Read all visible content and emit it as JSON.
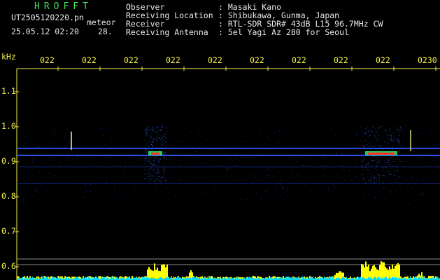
{
  "header": {
    "brand": "HROFFT",
    "filename": "UT2505120220.pn",
    "mode": "meteor",
    "datetime": "25.05.12 02:20",
    "count": "28.",
    "info": [
      {
        "label": "Observer",
        "value": ": Masaki Kano"
      },
      {
        "label": "Receiving Location",
        "value": ": Shibukawa, Gunma, Japan"
      },
      {
        "label": "Receiver",
        "value": ": RTL-SDR SDR# 43dB L15 96.7MHz CW"
      },
      {
        "label": "Receiving Antenna",
        "value": ": 5el Yagi Az 280 for Seoul"
      }
    ]
  },
  "axes": {
    "y_unit": "kHz",
    "y_ticks": [
      "1.1",
      "1.0",
      "0.9",
      "0.8",
      "0.7",
      "0.6"
    ],
    "x_ticks": [
      "022",
      "022",
      "022",
      "022",
      "022",
      "022",
      "022",
      "022",
      "022",
      "0230"
    ]
  },
  "colors": {
    "text": "#e8e8e8",
    "labels": "#f2f24a",
    "brand": "#3fe05a",
    "carrier": "#2a55ff",
    "echo_hot": "#ff2a2a",
    "echo_mid": "#30e060",
    "amplitude": "#ffff00",
    "noise_floor": "#00d8ff"
  }
}
